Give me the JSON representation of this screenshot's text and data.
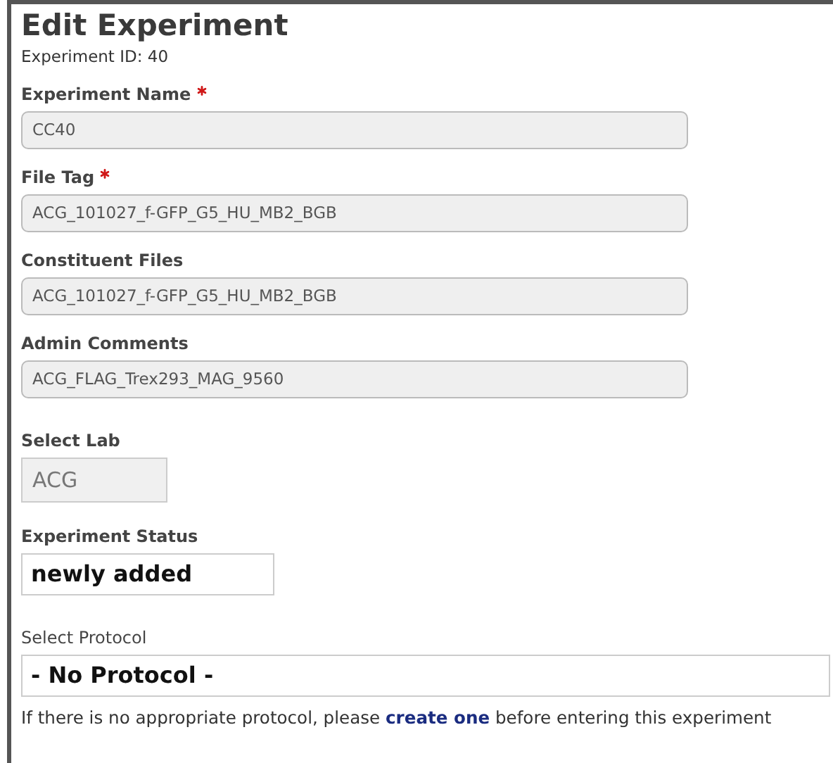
{
  "title": "Edit Experiment",
  "subtitle": "Experiment ID: 40",
  "fields": [
    {
      "label": "Experiment Name",
      "required": true,
      "kind": "text",
      "value": "CC40"
    },
    {
      "label": "File Tag",
      "required": true,
      "kind": "text",
      "value": "ACG_101027_f-GFP_G5_HU_MB2_BGB"
    },
    {
      "label": "Constituent Files",
      "required": false,
      "kind": "text",
      "value": "ACG_101027_f-GFP_G5_HU_MB2_BGB"
    },
    {
      "label": "Admin Comments",
      "required": false,
      "kind": "text",
      "value": "ACG_FLAG_Trex293_MAG_9560"
    },
    {
      "label": "Select Lab",
      "required": false,
      "kind": "lab",
      "value": "ACG"
    },
    {
      "label": "Experiment Status",
      "required": false,
      "kind": "status",
      "value": "newly added"
    },
    {
      "label": "Select Protocol",
      "required": false,
      "kind": "protocol",
      "value": "- No Protocol -"
    }
  ],
  "note": {
    "before": "If there is no appropriate protocol, please",
    "link": "create one",
    "after": "before entering this experiment"
  }
}
